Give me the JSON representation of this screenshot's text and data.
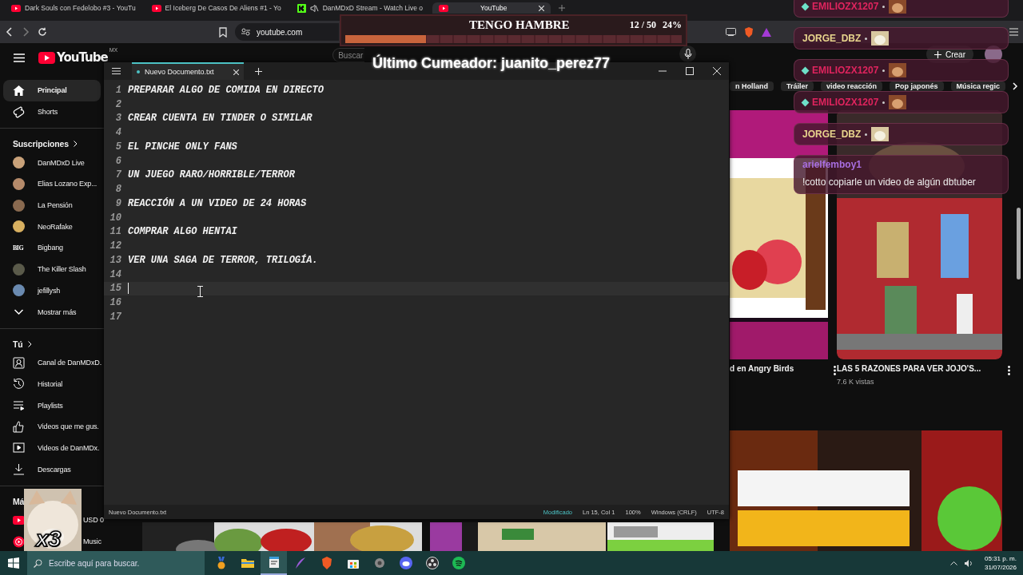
{
  "browser": {
    "tabs": [
      {
        "title": "Dark Souls con Fedelobo #3 - YouTu",
        "kind": "youtube",
        "selected": false,
        "muted": false
      },
      {
        "title": "El Iceberg De Casos De Aliens #1 - Yo",
        "kind": "youtube",
        "selected": false,
        "muted": false
      },
      {
        "title": "DanMDxD Stream - Watch Live o",
        "kind": "kick",
        "selected": false,
        "muted": true
      },
      {
        "title": "YouTube",
        "kind": "youtube",
        "selected": true,
        "muted": false
      }
    ],
    "address": "youtube.com"
  },
  "youtube": {
    "logo": "YouTube",
    "region": "MX",
    "search": {
      "placeholder": "Buscar"
    },
    "create_button": "Crear",
    "sidebar": {
      "main": [
        {
          "label": "Principal",
          "selected": true
        },
        {
          "label": "Shorts",
          "selected": false
        }
      ],
      "subscriptions": {
        "title": "Suscripciones",
        "channels": [
          {
            "name": "DanMDxD Live"
          },
          {
            "name": "Elias Lozano Exp..."
          },
          {
            "name": "La Pensión"
          },
          {
            "name": "NeoRafake"
          },
          {
            "name": "Bigbang",
            "avatar_text": "BIG"
          },
          {
            "name": "The Killer Slash"
          },
          {
            "name": "jefillysh"
          }
        ],
        "show_more": "Mostrar más"
      },
      "you": {
        "title": "Tú",
        "items": [
          "Canal de DanMDxD.",
          "Historial",
          "Playlists",
          "Videos que me gus.",
          "Videos de DanMDx.",
          "Descargas"
        ]
      },
      "more": {
        "title": "Má",
        "items": [
          "USD 0",
          "Music"
        ]
      }
    },
    "chips": [
      "n Holland",
      "Tráiler",
      "video reacción",
      "Pop japonés",
      "Música regic"
    ],
    "videos": [
      {
        "title": "d en Angry Birds"
      },
      {
        "title": "LAS 5 RAZONES PARA VER JOJO'S...",
        "meta": "7.6 K vistas"
      }
    ]
  },
  "notepad": {
    "tab": {
      "title": "Nuevo Documento.txt",
      "modified": true
    },
    "lines": [
      {
        "number": "1",
        "text": "PREPARAR ALGO DE COMIDA EN DIRECTO",
        "current": false
      },
      {
        "number": "2",
        "current": false
      },
      {
        "number": "3",
        "text": "CREAR CUENTA EN TINDER O SIMILAR",
        "current": false
      },
      {
        "number": "4",
        "current": false
      },
      {
        "number": "5",
        "text": "EL PINCHE ONLY FANS",
        "current": false
      },
      {
        "number": "6",
        "current": false
      },
      {
        "number": "7",
        "text": "UN JUEGO RARO/HORRIBLE/TERROR",
        "current": false
      },
      {
        "number": "8",
        "current": false
      },
      {
        "number": "9",
        "text": "REACCIÓN A UN VIDEO DE 24 HORAS",
        "current": false
      },
      {
        "number": "10",
        "current": false
      },
      {
        "number": "11",
        "text": "COMPRAR ALGO HENTAI",
        "current": false
      },
      {
        "number": "12",
        "current": false
      },
      {
        "number": "13",
        "text": "VER UNA SAGA DE TERROR, TRILOGÍA.",
        "current": false
      },
      {
        "number": "14",
        "current": false
      },
      {
        "number": "15",
        "current": true
      },
      {
        "number": "16",
        "current": false
      },
      {
        "number": "17",
        "current": false
      }
    ],
    "status": {
      "file": "Nuevo Documento.txt",
      "state": "Modificado",
      "position": "Ln 15, Col 1",
      "zoom": "100%",
      "line_ending": "Windows (CRLF)",
      "encoding": "UTF-8"
    }
  },
  "overlay": {
    "goal": {
      "title": "TENGO HAMBRE",
      "count": "12 / 50",
      "percent": "24%",
      "level": 0.24
    },
    "last_user": "Último Cumeador: juanito_perez77",
    "chat": [
      {
        "user": "EMILIOZX1207",
        "color": "#e0245e",
        "badge": true
      },
      {
        "user": "JORGE_DBZ",
        "color": "#e8d58c",
        "badge": false
      },
      {
        "user": "EMILIOZX1207",
        "color": "#e0245e",
        "badge": true
      },
      {
        "user": "EMILIOZX1207",
        "color": "#e0245e",
        "badge": true
      },
      {
        "user": "JORGE_DBZ",
        "color": "#e8d58c",
        "badge": false
      },
      {
        "user": "arielfemboy1",
        "color": "#a86ee0",
        "badge": false,
        "message": "!cotto copiarle un video de algún dbtuber"
      }
    ],
    "combo": "x3"
  },
  "taskbar": {
    "search": {
      "placeholder": "Escribe aquí para buscar."
    },
    "apps": [
      {
        "selected": false
      },
      {
        "selected": false
      },
      {
        "selected": true
      },
      {
        "selected": false
      },
      {
        "selected": false
      },
      {
        "selected": false
      },
      {
        "selected": false
      },
      {
        "selected": false
      },
      {
        "selected": false
      },
      {
        "selected": false
      }
    ],
    "time": "05:31 p. m.",
    "date": "31/07/2026"
  }
}
